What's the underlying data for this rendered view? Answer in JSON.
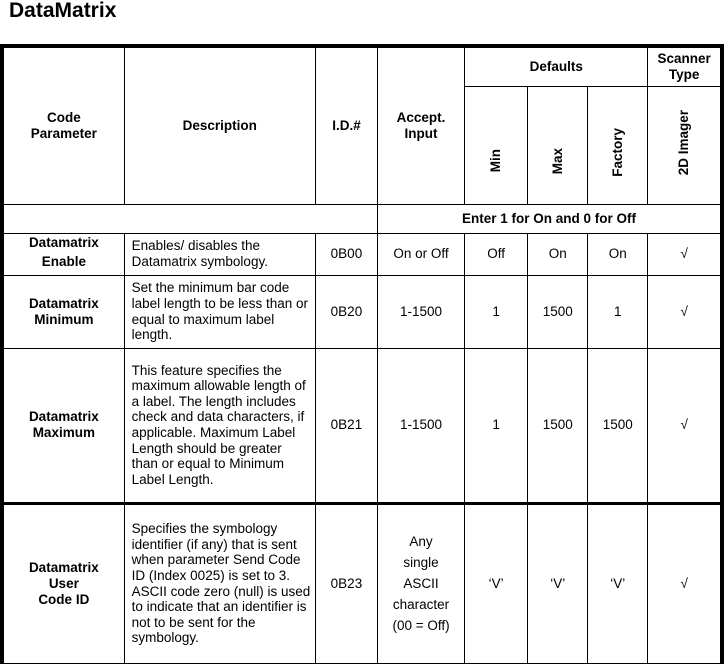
{
  "title": "DataMatrix",
  "headers": {
    "code_parameter": "Code Parameter",
    "description": "Description",
    "id": "I.D.#",
    "accept_input": "Accept. Input",
    "defaults": "Defaults",
    "scanner_type": "Scanner Type",
    "min": "Min",
    "max": "Max",
    "factory": "Factory",
    "imager": "2D Imager"
  },
  "note": "Enter 1 for On and 0 for Off",
  "rows": [
    {
      "param_line1": "Datamatrix",
      "param_line2": "Enable",
      "description": "Enables/ disables the Datamatrix symbology.",
      "id": "0B00",
      "accept": "On or Off",
      "min": "Off",
      "max": "On",
      "factory": "On",
      "imager": "√"
    },
    {
      "param_line1": "Datamatrix",
      "param_line2": "Minimum",
      "description": "Set the minimum bar code label length to be less than or equal to maximum label length.",
      "id": "0B20",
      "accept": "1-1500",
      "min": "1",
      "max": "1500",
      "factory": "1",
      "imager": "√"
    },
    {
      "param_line1": "Datamatrix",
      "param_line2": "Maximum",
      "description": "This feature specifies the maximum allowable length of a label. The length includes check and data characters, if applicable. Maximum Label Length should be greater than or equal to Minimum Label Length.",
      "id": "0B21",
      "accept": "1-1500",
      "min": "1",
      "max": "1500",
      "factory": "1500",
      "imager": "√"
    },
    {
      "param_line1": "Datamatrix",
      "param_line2": "User",
      "param_line3": "Code ID",
      "description": "Specifies the symbology identifier (if any) that is sent when parameter Send Code ID (Index 0025) is set to 3. ASCII code zero (null) is used to indicate that an identifier is not to be sent for the symbology.",
      "id": "0B23",
      "accept_lines": [
        "Any",
        "single",
        "ASCII",
        "character",
        "(00 = Off)"
      ],
      "min": "‘V’",
      "max": "‘V’",
      "factory": "‘V’",
      "imager": "√"
    }
  ]
}
